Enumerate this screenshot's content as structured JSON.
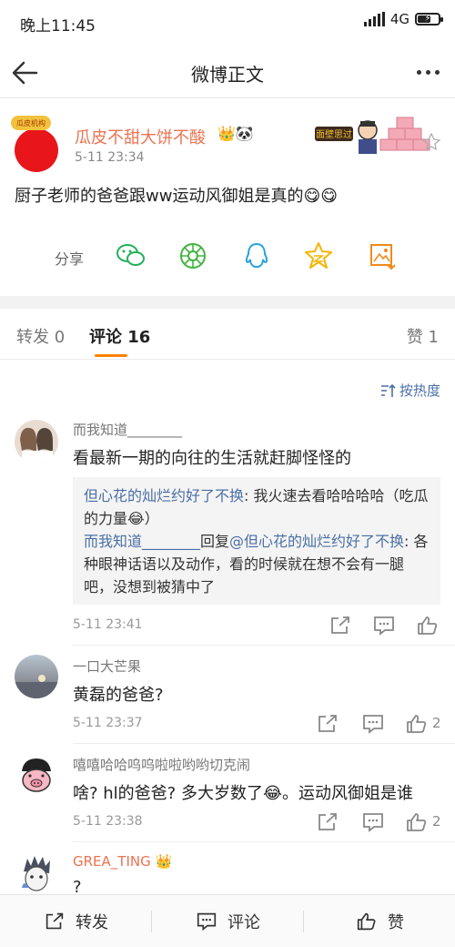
{
  "status_bar": {
    "time": "晚上11:45",
    "network": "4G",
    "battery_percent": 60
  },
  "nav": {
    "title": "微博正文"
  },
  "post": {
    "author": "瓜皮不甜大饼不酸",
    "author_badge_emoji": "👑🐼",
    "avatar_badge": "瓜皮机构",
    "card_label": "面壁思过",
    "time": "5-11 23:34",
    "text": "厨子老师的爸爸跟ww运动风御姐是真的😋😋",
    "share_label": "分享",
    "share_icons": [
      "wechat-icon",
      "moments-icon",
      "qq-icon",
      "qzone-icon",
      "save-image-icon"
    ]
  },
  "tabs": {
    "repost": "转发 0",
    "comments": "评论 16",
    "likes": "赞 1"
  },
  "sort": {
    "label": "按热度"
  },
  "comments": [
    {
      "name": "而我知道________",
      "text": "看最新一期的向往的生活就赶脚怪怪的",
      "time": "5-11 23:41",
      "likes": "",
      "replies": {
        "r1_user": "但心花的灿烂约好了不换",
        "r1_text": ": 我火速去看哈哈哈哈（吃瓜的力量😂）",
        "r2_user": "而我知道________",
        "r2_mid": "回复",
        "r2_target": "@但心花的灿烂约好了不换",
        "r2_text": ": 各种眼神话语以及动作，看的时候就在想不会有一腿吧，没想到被猜中了"
      }
    },
    {
      "name": "一口大芒果",
      "text": "黄磊的爸爸?",
      "time": "5-11 23:37",
      "likes": "2"
    },
    {
      "name": "嘻嘻哈哈呜呜啦啦哟哟切克闹",
      "text": "啥? hl的爸爸? 多大岁数了😂。运动风御姐是谁",
      "time": "5-11 23:38",
      "likes": "2"
    },
    {
      "name": "GREA_TING",
      "name_emoji": "👑",
      "text": "?",
      "time": ""
    }
  ],
  "bottom_bar": {
    "repost": "转发",
    "comment": "评论",
    "like": "赞"
  },
  "colors": {
    "accent": "#ff8200",
    "name_orange": "#eb7350",
    "link_blue": "#4a6fa5",
    "avatar_red": "#e8161b"
  }
}
